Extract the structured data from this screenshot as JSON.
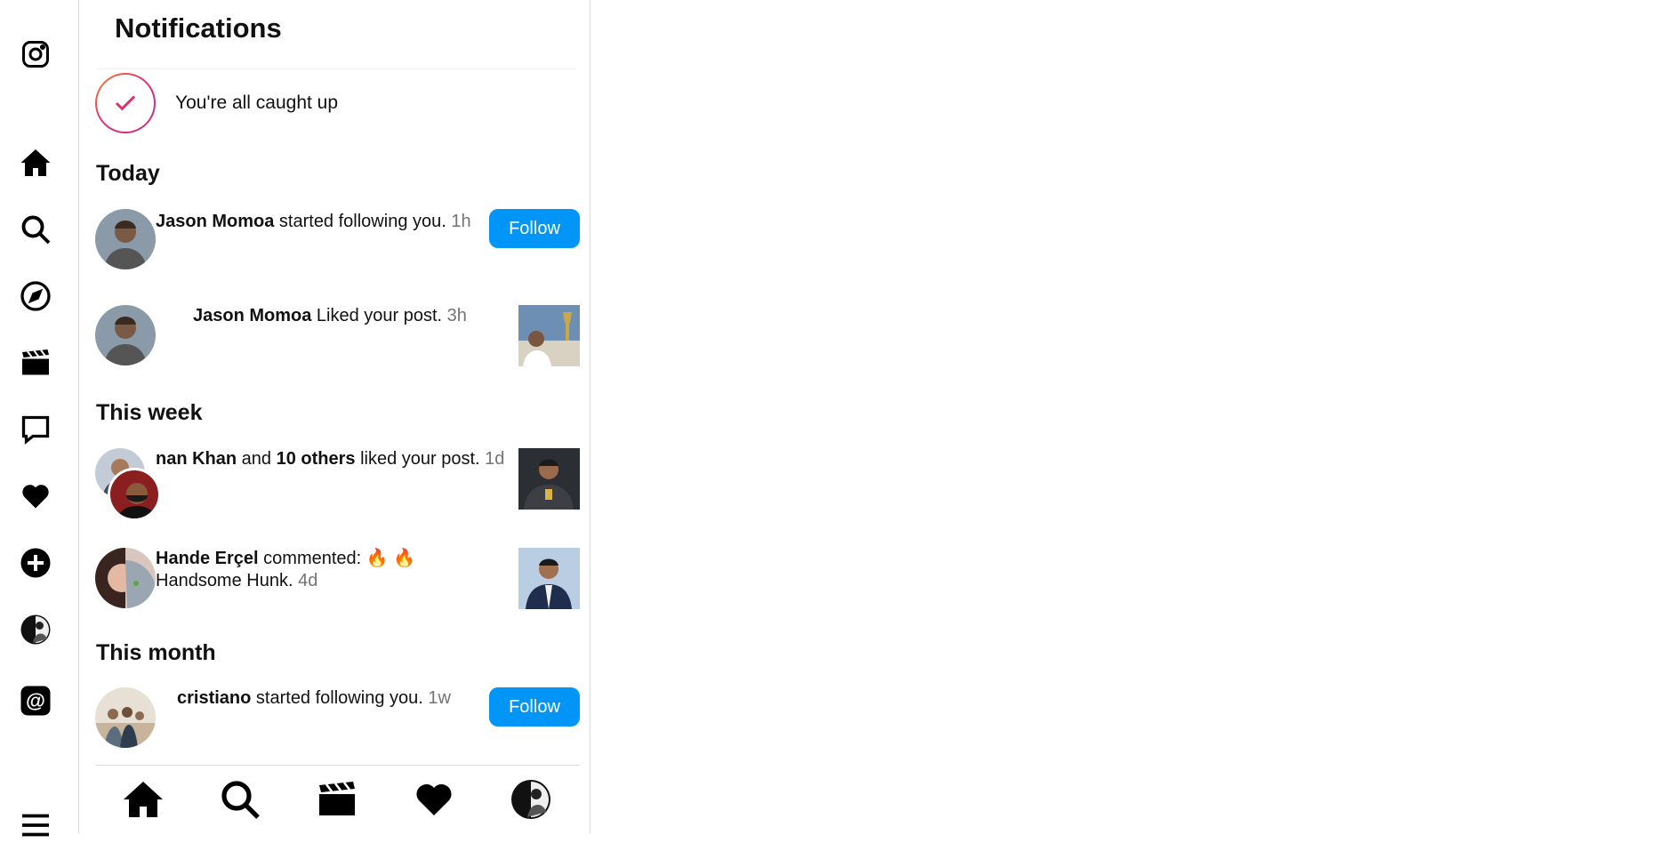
{
  "sidebar": {
    "icons": [
      "instagram-logo-icon",
      "home-icon",
      "search-icon",
      "explore-compass-icon",
      "reels-icon",
      "messages-icon",
      "heart-icon",
      "create-plus-icon",
      "profile-avatar",
      "threads-icon",
      "menu-hamburger-icon"
    ]
  },
  "notifications": {
    "title": "Notifications",
    "caught_up": "You're all caught up",
    "sections": {
      "today": "Today",
      "this_week": "This week",
      "this_month": "This month"
    },
    "items": [
      {
        "user": "Jason Momoa",
        "action": " started following you. ",
        "time": "1h",
        "button": "Follow"
      },
      {
        "user": "Jason Momoa",
        "action": " Liked your post. ",
        "time": "3h"
      },
      {
        "user": "nan Khan",
        "connector": " and ",
        "others": "10 others",
        "action": " liked your post. ",
        "time": "1d"
      },
      {
        "user": "Hande Erçel",
        "action": " commented: ",
        "emoji": "🔥 🔥",
        "comment": "Handsome Hunk. ",
        "time": "4d"
      },
      {
        "user": "cristiano",
        "action": " started following you. ",
        "time": "1w",
        "button": "Follow"
      }
    ]
  },
  "colors": {
    "accent": "#0095f6",
    "ring_start": "#f58529",
    "ring_end": "#c13584"
  }
}
